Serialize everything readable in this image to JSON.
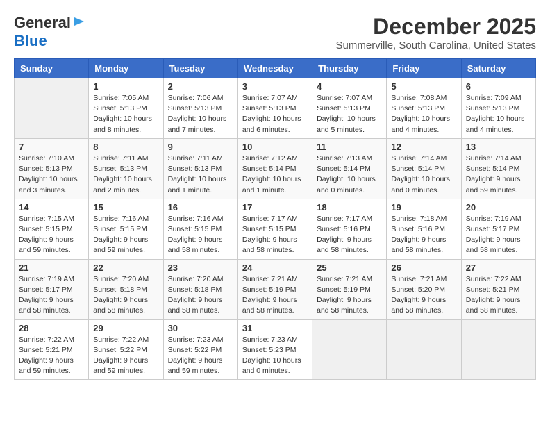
{
  "header": {
    "logo_line1": "General",
    "logo_line2": "Blue",
    "month": "December 2025",
    "location": "Summerville, South Carolina, United States"
  },
  "weekdays": [
    "Sunday",
    "Monday",
    "Tuesday",
    "Wednesday",
    "Thursday",
    "Friday",
    "Saturday"
  ],
  "weeks": [
    [
      {
        "num": "",
        "empty": true
      },
      {
        "num": "1",
        "sunrise": "7:05 AM",
        "sunset": "5:13 PM",
        "daylight": "10 hours and 8 minutes."
      },
      {
        "num": "2",
        "sunrise": "7:06 AM",
        "sunset": "5:13 PM",
        "daylight": "10 hours and 7 minutes."
      },
      {
        "num": "3",
        "sunrise": "7:07 AM",
        "sunset": "5:13 PM",
        "daylight": "10 hours and 6 minutes."
      },
      {
        "num": "4",
        "sunrise": "7:07 AM",
        "sunset": "5:13 PM",
        "daylight": "10 hours and 5 minutes."
      },
      {
        "num": "5",
        "sunrise": "7:08 AM",
        "sunset": "5:13 PM",
        "daylight": "10 hours and 4 minutes."
      },
      {
        "num": "6",
        "sunrise": "7:09 AM",
        "sunset": "5:13 PM",
        "daylight": "10 hours and 4 minutes."
      }
    ],
    [
      {
        "num": "7",
        "sunrise": "7:10 AM",
        "sunset": "5:13 PM",
        "daylight": "10 hours and 3 minutes."
      },
      {
        "num": "8",
        "sunrise": "7:11 AM",
        "sunset": "5:13 PM",
        "daylight": "10 hours and 2 minutes."
      },
      {
        "num": "9",
        "sunrise": "7:11 AM",
        "sunset": "5:13 PM",
        "daylight": "10 hours and 1 minute."
      },
      {
        "num": "10",
        "sunrise": "7:12 AM",
        "sunset": "5:14 PM",
        "daylight": "10 hours and 1 minute."
      },
      {
        "num": "11",
        "sunrise": "7:13 AM",
        "sunset": "5:14 PM",
        "daylight": "10 hours and 0 minutes."
      },
      {
        "num": "12",
        "sunrise": "7:14 AM",
        "sunset": "5:14 PM",
        "daylight": "10 hours and 0 minutes."
      },
      {
        "num": "13",
        "sunrise": "7:14 AM",
        "sunset": "5:14 PM",
        "daylight": "9 hours and 59 minutes."
      }
    ],
    [
      {
        "num": "14",
        "sunrise": "7:15 AM",
        "sunset": "5:15 PM",
        "daylight": "9 hours and 59 minutes."
      },
      {
        "num": "15",
        "sunrise": "7:16 AM",
        "sunset": "5:15 PM",
        "daylight": "9 hours and 59 minutes."
      },
      {
        "num": "16",
        "sunrise": "7:16 AM",
        "sunset": "5:15 PM",
        "daylight": "9 hours and 58 minutes."
      },
      {
        "num": "17",
        "sunrise": "7:17 AM",
        "sunset": "5:15 PM",
        "daylight": "9 hours and 58 minutes."
      },
      {
        "num": "18",
        "sunrise": "7:17 AM",
        "sunset": "5:16 PM",
        "daylight": "9 hours and 58 minutes."
      },
      {
        "num": "19",
        "sunrise": "7:18 AM",
        "sunset": "5:16 PM",
        "daylight": "9 hours and 58 minutes."
      },
      {
        "num": "20",
        "sunrise": "7:19 AM",
        "sunset": "5:17 PM",
        "daylight": "9 hours and 58 minutes."
      }
    ],
    [
      {
        "num": "21",
        "sunrise": "7:19 AM",
        "sunset": "5:17 PM",
        "daylight": "9 hours and 58 minutes."
      },
      {
        "num": "22",
        "sunrise": "7:20 AM",
        "sunset": "5:18 PM",
        "daylight": "9 hours and 58 minutes."
      },
      {
        "num": "23",
        "sunrise": "7:20 AM",
        "sunset": "5:18 PM",
        "daylight": "9 hours and 58 minutes."
      },
      {
        "num": "24",
        "sunrise": "7:21 AM",
        "sunset": "5:19 PM",
        "daylight": "9 hours and 58 minutes."
      },
      {
        "num": "25",
        "sunrise": "7:21 AM",
        "sunset": "5:19 PM",
        "daylight": "9 hours and 58 minutes."
      },
      {
        "num": "26",
        "sunrise": "7:21 AM",
        "sunset": "5:20 PM",
        "daylight": "9 hours and 58 minutes."
      },
      {
        "num": "27",
        "sunrise": "7:22 AM",
        "sunset": "5:21 PM",
        "daylight": "9 hours and 58 minutes."
      }
    ],
    [
      {
        "num": "28",
        "sunrise": "7:22 AM",
        "sunset": "5:21 PM",
        "daylight": "9 hours and 59 minutes."
      },
      {
        "num": "29",
        "sunrise": "7:22 AM",
        "sunset": "5:22 PM",
        "daylight": "9 hours and 59 minutes."
      },
      {
        "num": "30",
        "sunrise": "7:23 AM",
        "sunset": "5:22 PM",
        "daylight": "9 hours and 59 minutes."
      },
      {
        "num": "31",
        "sunrise": "7:23 AM",
        "sunset": "5:23 PM",
        "daylight": "10 hours and 0 minutes."
      },
      {
        "num": "",
        "empty": true
      },
      {
        "num": "",
        "empty": true
      },
      {
        "num": "",
        "empty": true
      }
    ]
  ]
}
